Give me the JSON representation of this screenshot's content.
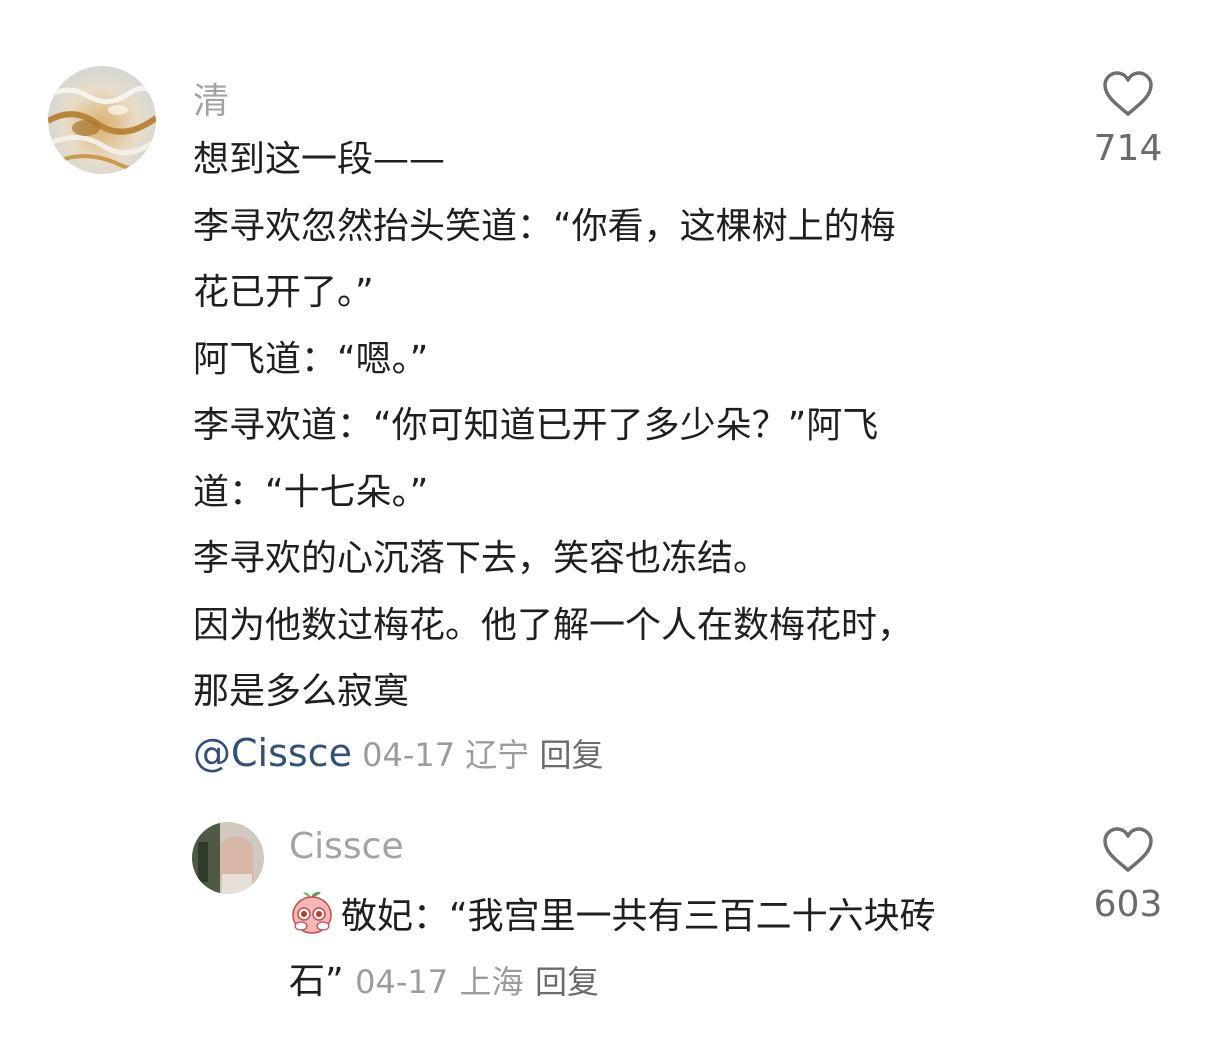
{
  "comment": {
    "username": "清",
    "lines": [
      "想到这一段——",
      "李寻欢忽然抬头笑道：“你看，这棵树上的梅",
      "花已开了。”",
      "阿飞道：“嗯。”",
      "李寻欢道：“你可知道已开了多少朵？”阿飞",
      "道：“十七朵。”",
      "李寻欢的心沉落下去，笑容也冻结。",
      "因为他数过梅花。他了解一个人在数梅花时，",
      "那是多么寂寞"
    ],
    "mention": "@Cissce",
    "date": "04-17",
    "location": "辽宁",
    "reply_label": "回复",
    "likes": "714",
    "avatar_icon": "gold-water-ripple-avatar"
  },
  "reply": {
    "username": "Cissce",
    "emoji_icon": "peach-blush-emoji",
    "text_line1": "敬妃：“我宫里一共有三百二十六块砖",
    "text_line2": "石”",
    "date": "04-17",
    "location": "上海",
    "reply_label": "回复",
    "likes": "603",
    "avatar_icon": "portrait-photo-avatar"
  },
  "colors": {
    "mention": "#33507a",
    "meta": "#9c9c9c",
    "username": "#a3a3a3",
    "text": "#1f1f1f"
  }
}
